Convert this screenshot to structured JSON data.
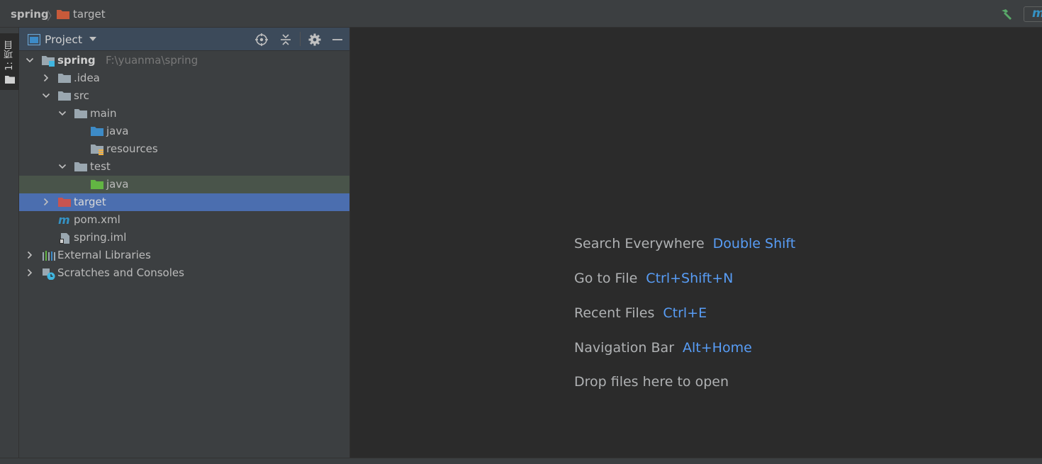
{
  "navbar": {
    "breadcrumb": [
      "spring",
      "target"
    ],
    "maven_label": "m"
  },
  "tool_strip": {
    "project_tab_label": "1: 项目"
  },
  "panel": {
    "title": "Project"
  },
  "tree": [
    {
      "label": "spring",
      "sub": "F:\\yuanma\\spring",
      "depth": 0,
      "expanded": true,
      "icon": "module-folder-icon"
    },
    {
      "label": ".idea",
      "depth": 1,
      "expanded": false,
      "icon": "folder-icon"
    },
    {
      "label": "src",
      "depth": 1,
      "expanded": true,
      "icon": "folder-icon"
    },
    {
      "label": "main",
      "depth": 2,
      "expanded": true,
      "icon": "folder-icon"
    },
    {
      "label": "java",
      "depth": 3,
      "icon": "source-folder-icon"
    },
    {
      "label": "resources",
      "depth": 3,
      "icon": "resources-folder-icon"
    },
    {
      "label": "test",
      "depth": 2,
      "expanded": true,
      "icon": "folder-icon"
    },
    {
      "label": "java",
      "depth": 3,
      "icon": "test-source-folder-icon"
    },
    {
      "label": "target",
      "depth": 1,
      "expanded": false,
      "icon": "excluded-folder-icon",
      "selected": true
    },
    {
      "label": "pom.xml",
      "depth": 1,
      "icon": "maven-file-icon"
    },
    {
      "label": "spring.iml",
      "depth": 1,
      "icon": "iml-file-icon"
    },
    {
      "label": "External Libraries",
      "depth": 0,
      "expanded": false,
      "icon": "libraries-icon"
    },
    {
      "label": "Scratches and Consoles",
      "depth": 0,
      "expanded": false,
      "icon": "scratches-icon"
    }
  ],
  "editor": {
    "hints": [
      {
        "label": "Search Everywhere",
        "shortcut": "Double Shift"
      },
      {
        "label": "Go to File",
        "shortcut": "Ctrl+Shift+N"
      },
      {
        "label": "Recent Files",
        "shortcut": "Ctrl+E"
      },
      {
        "label": "Navigation Bar",
        "shortcut": "Alt+Home"
      },
      {
        "label": "Drop files here to open",
        "shortcut": ""
      }
    ]
  },
  "colors": {
    "selection": "#4b6eaf",
    "test_highlight": "#49544a",
    "shortcut": "#589df6",
    "excluded_folder": "#c75450",
    "source_folder": "#3d8bc7",
    "test_folder": "#62b543"
  }
}
